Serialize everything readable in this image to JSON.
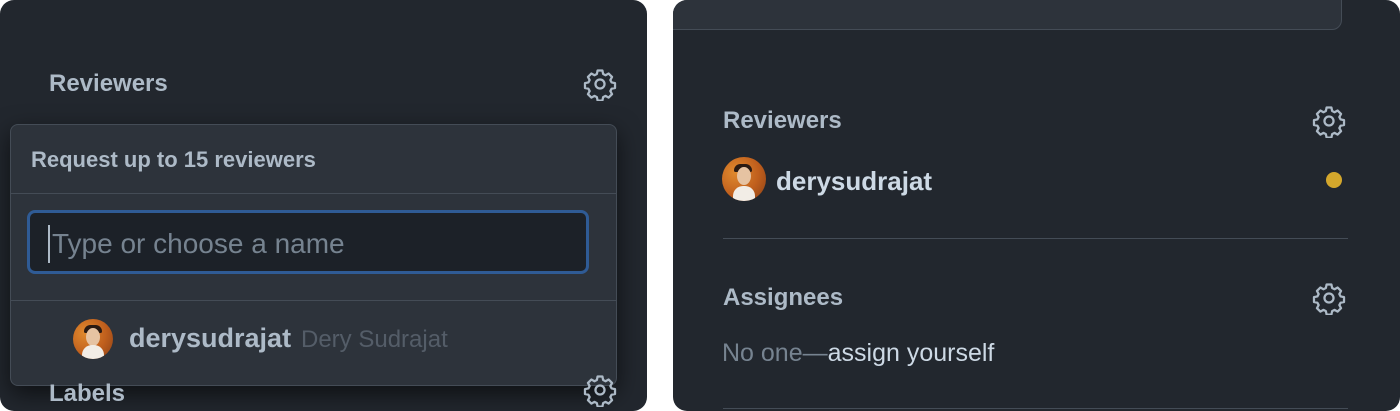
{
  "left": {
    "reviewers_title": "Reviewers",
    "popup": {
      "header": "Request up to 15 reviewers",
      "filter_placeholder": "Type or choose a name",
      "suggestion": {
        "login": "derysudrajat",
        "name": "Dery Sudrajat"
      }
    },
    "labels_title": "Labels",
    "gear_icon": "gear-icon"
  },
  "right": {
    "reviewers_title": "Reviewers",
    "reviewer": {
      "login": "derysudrajat",
      "status_color": "#d4a72c"
    },
    "assignees_title": "Assignees",
    "assignees_none": "No one—",
    "assign_yourself": "assign yourself",
    "gear_icon": "gear-icon"
  },
  "colors": {
    "panel": "#22272e",
    "popup": "#2d333b",
    "focus_border": "#2f5b95",
    "pending": "#d4a72c"
  }
}
